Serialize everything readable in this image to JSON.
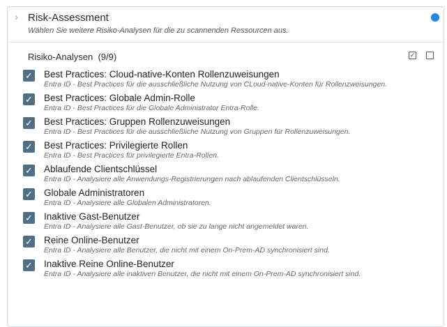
{
  "header": {
    "title": "Risk-Assessment",
    "subtitle": "Wählen Sie weitere Risiko-Analysen für die zu scannenden Ressourcen aus.",
    "chevron_icon": "chevron-right-icon",
    "status_color": "#1e88e5"
  },
  "section": {
    "label": "Risiko-Analysen",
    "count": "(9/9)",
    "select_all_icon": "checkbox-checked-icon",
    "select_none_icon": "checkbox-empty-icon"
  },
  "checkbox_color": "#4f6f87",
  "items": [
    {
      "title": "Best Practices: Cloud-native-Konten Rollenzuweisungen",
      "desc": "Entra ID - Best Practices für die ausschließliche Nutzung von CLoud-native-Konten für Rollenzweisungen.",
      "checked": true
    },
    {
      "title": "Best Practices: Globale Admin-Rolle",
      "desc": "Entra ID - Best Practices für die Globale Administrator Entra-Rolle.",
      "checked": true
    },
    {
      "title": "Best Practices: Gruppen Rollenzuweisungen",
      "desc": "Entra ID - Best Practices für die ausschließliche Nutzung von Gruppen für Rollenzuweisungen.",
      "checked": true
    },
    {
      "title": "Best Practices: Privilegierte Rollen",
      "desc": "Entra ID - Best Practices für privilegierte Entra-Rollen.",
      "checked": true
    },
    {
      "title": "Ablaufende Clientschlüssel",
      "desc": "Entra ID - Analysiere alle Anwendungs-Registrierungen nach ablaufenden Clientschlüsseln.",
      "checked": true
    },
    {
      "title": "Globale Administratoren",
      "desc": "Entra ID - Analysiere alle Globalen Administratoren.",
      "checked": true
    },
    {
      "title": "Inaktive Gast-Benutzer",
      "desc": "Entra ID - Analysiere alle Gast-Benutzer, ob sie zu lange nicht angemeldet waren.",
      "checked": true
    },
    {
      "title": "Reine Online-Benutzer",
      "desc": "Entra ID - Analysiere alle Benutzer, die nicht mit einem On-Prem-AD synchronisiert sind.",
      "checked": true
    },
    {
      "title": "Inaktive Reine Online-Benutzer",
      "desc": "Entra ID - Analysiere alle inaktiven Benutzer, die nicht mit einem On-Prem-AD synchronisiert sind.",
      "checked": true
    }
  ]
}
